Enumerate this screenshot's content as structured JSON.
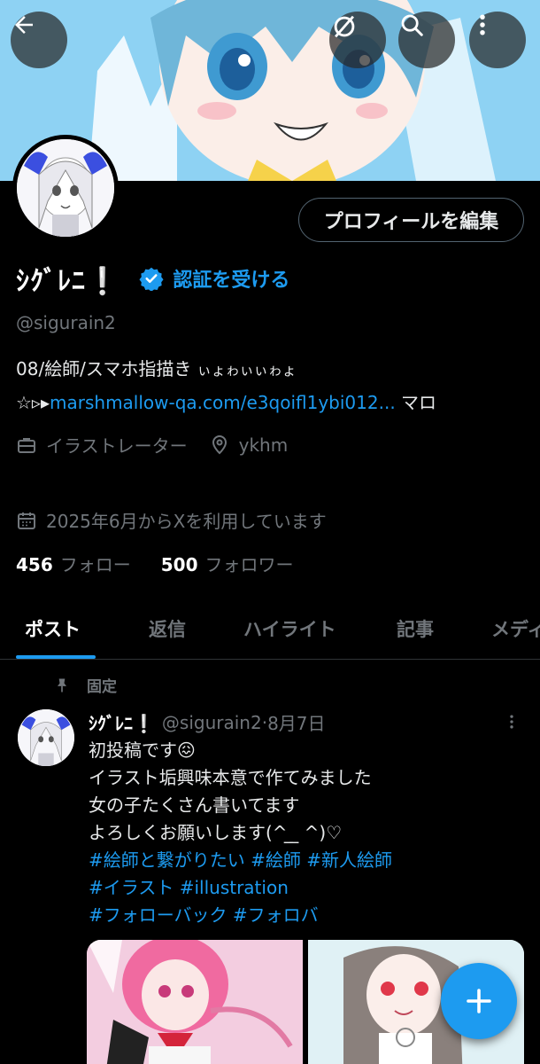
{
  "header": {
    "back_icon": "arrow-left-icon",
    "no_star_icon": "circle-slash-icon",
    "search_icon": "search-icon",
    "more_icon": "more-vertical-icon"
  },
  "profile": {
    "edit_button_label": "プロフィールを編集",
    "display_name": "ｼｸﾞﾚﾆ❕",
    "verify_label": "認証を受ける",
    "handle": "@sigurain2",
    "bio_line1_main": "08/絵師/スマホ指描き ",
    "bio_line1_small": "ぃょゎぃぃゎょ",
    "bio_line2_prefix": "☆▹▸",
    "bio_line2_link": "marshmallow-qa.com/e3qoifl1ybi012...",
    "bio_line2_suffix": " マロ",
    "profession": "イラストレーター",
    "location": "ykhm",
    "joined": "2025年6月からXを利用しています",
    "following_count": "456",
    "following_label": "フォロー",
    "followers_count": "500",
    "followers_label": "フォロワー"
  },
  "tabs": [
    {
      "label": "ポスト",
      "active": true
    },
    {
      "label": "返信"
    },
    {
      "label": "ハイライト"
    },
    {
      "label": "記事"
    },
    {
      "label": "メディア"
    }
  ],
  "post": {
    "pinned_label": "固定",
    "author_name": "ｼｸﾞﾚﾆ❕",
    "author_handle": "@sigurain2",
    "separator": " · ",
    "date": "8月7日",
    "lines": [
      "初投稿です😖",
      "イラスト垢興味本意で作てみました",
      "女の子たくさん書いてます",
      "よろしくお願いします(^ ̲ ̲ ^)♡"
    ],
    "hashtags_line1": "#絵師と繋がりたい #絵師 #新人絵師",
    "hashtags_line2": "#イラスト #illustration",
    "hashtags_line3": "#フォローバック #フォロバ"
  },
  "fab": {
    "icon": "plus-icon"
  },
  "colors": {
    "accent": "#1d9bf0",
    "muted": "#71767b",
    "text": "#e7e9ea",
    "background": "#000000"
  }
}
